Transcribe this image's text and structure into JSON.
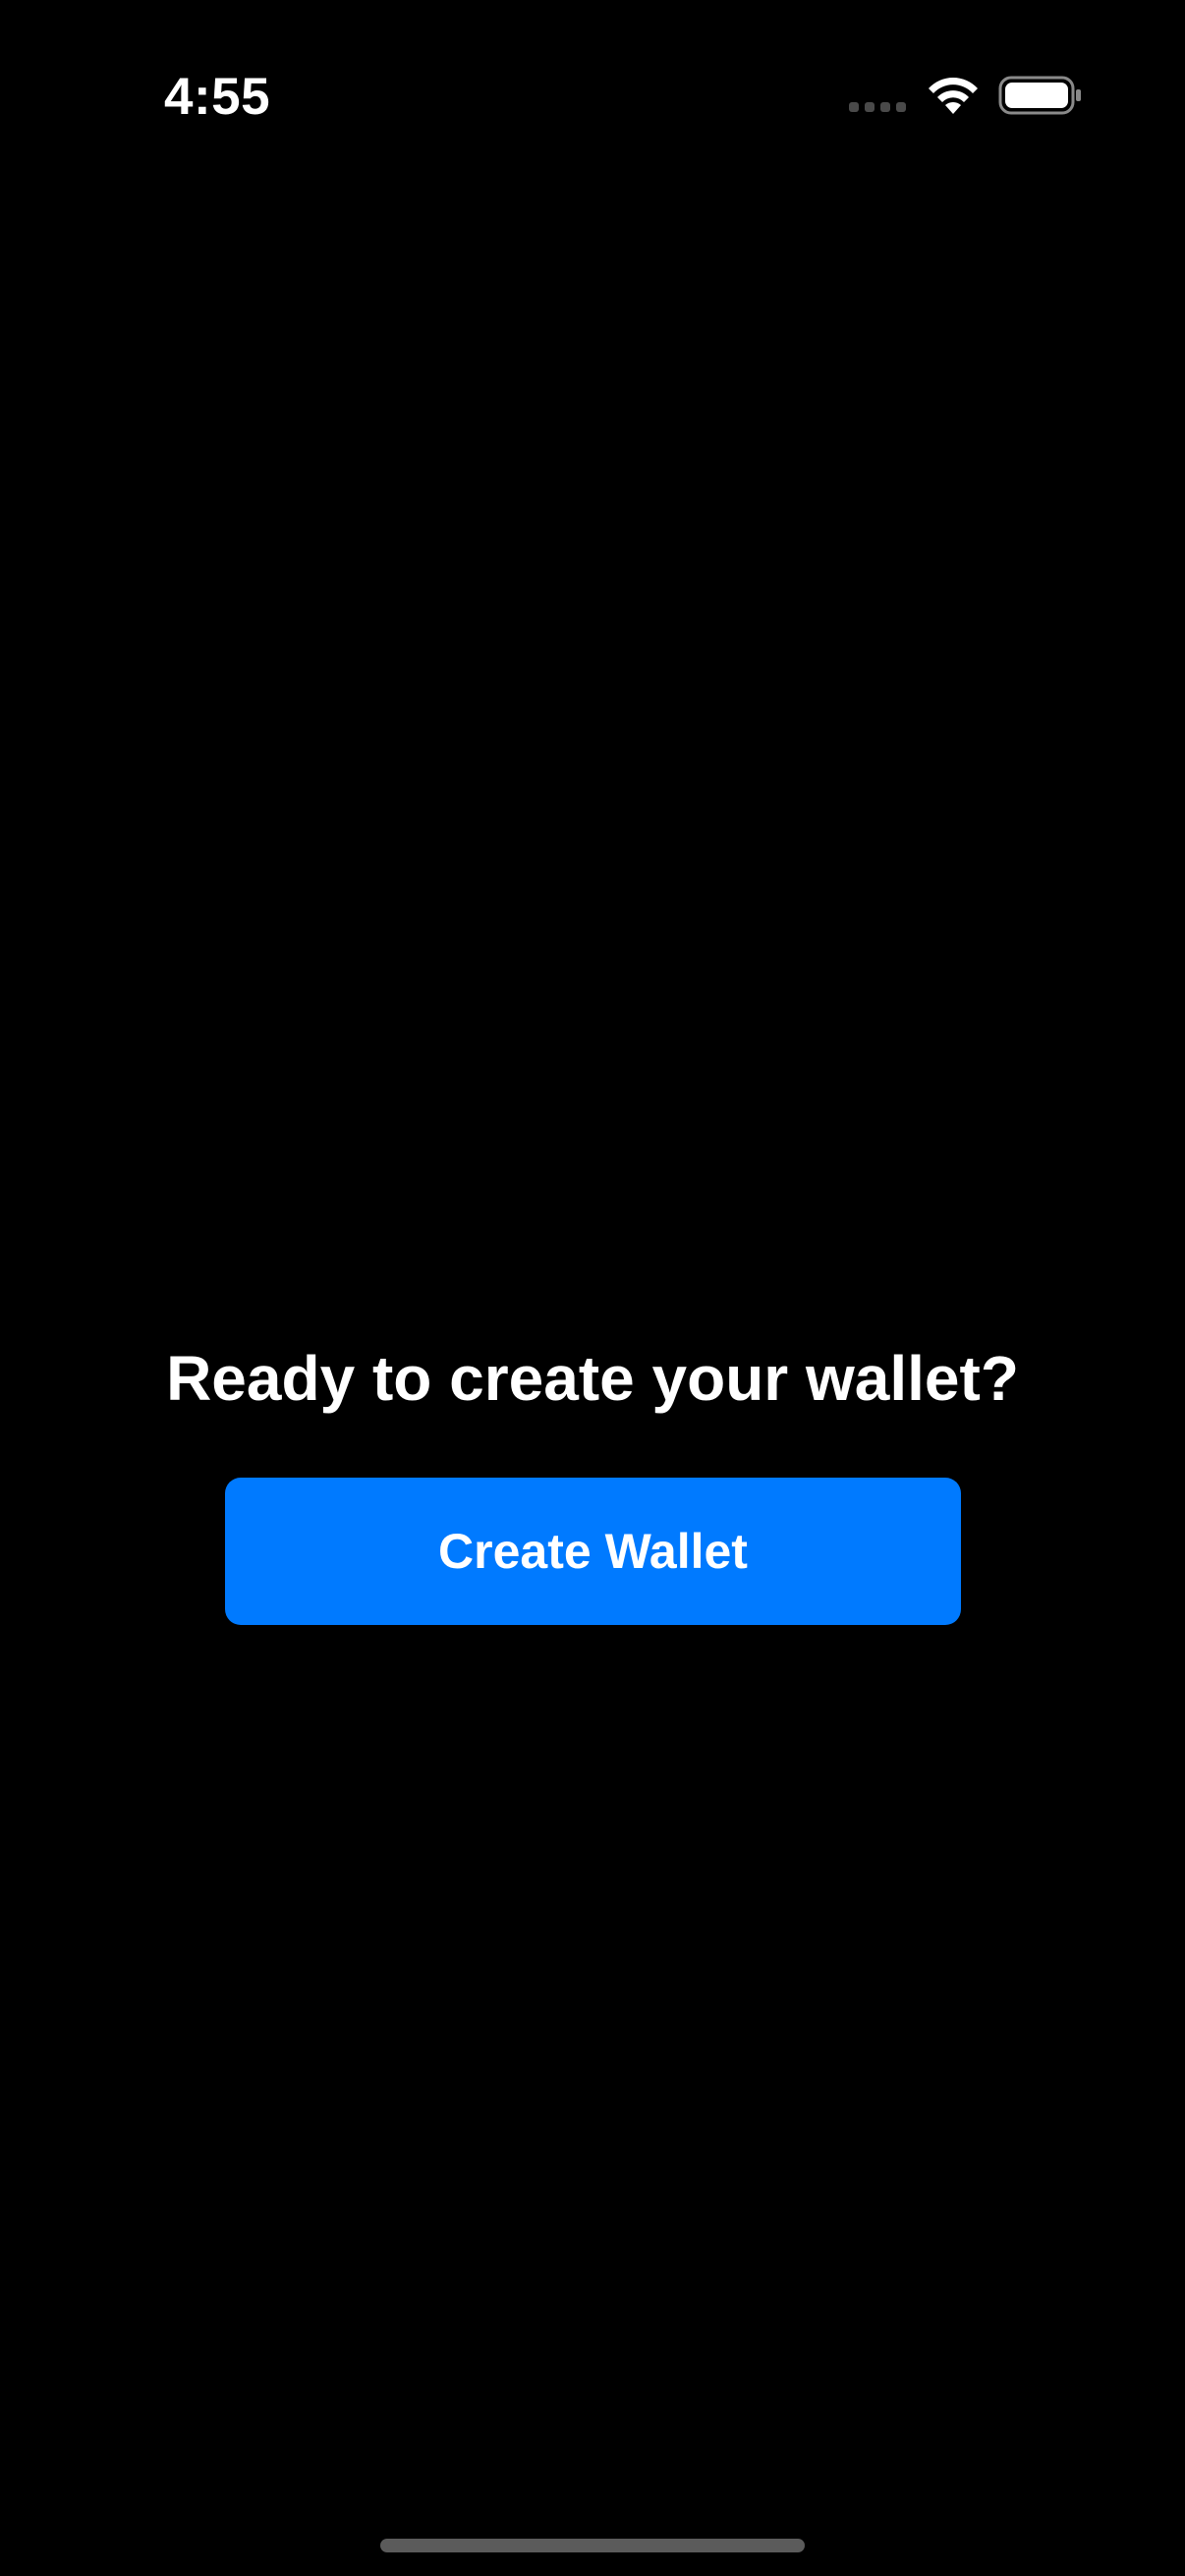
{
  "status_bar": {
    "time": "4:55",
    "icons": [
      "cellular-signal-icon",
      "wifi-icon",
      "battery-icon"
    ]
  },
  "main": {
    "title": "Ready to create your wallet?",
    "create_button_label": "Create Wallet"
  },
  "colors": {
    "background": "#000000",
    "accent": "#007AFF",
    "text": "#FFFFFF"
  }
}
